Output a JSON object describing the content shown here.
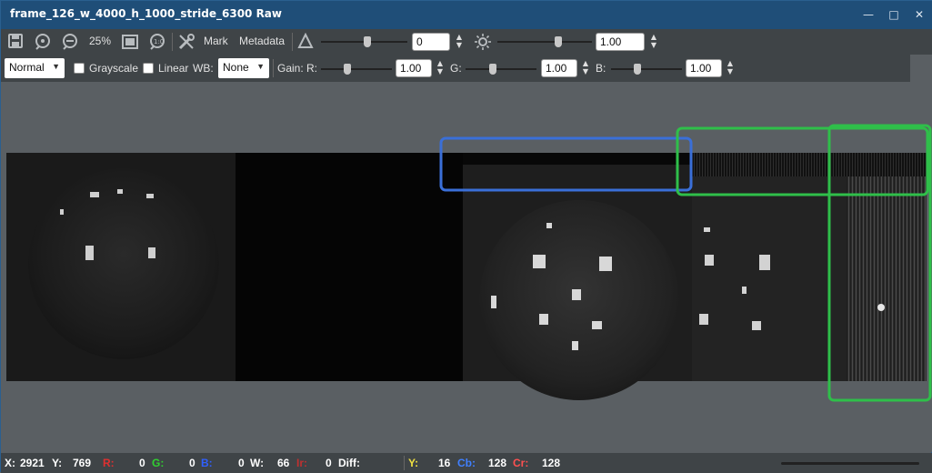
{
  "window": {
    "title": "frame_126_w_4000_h_1000_stride_6300 Raw",
    "minimize": "—",
    "maximize": "□",
    "close": "✕"
  },
  "toolbar1": {
    "zoom_label": "25%",
    "mark_label": "Mark",
    "metadata_label": "Metadata",
    "contrast_value": "0",
    "brightness_value": "1.00"
  },
  "toolbar2": {
    "blend_mode": "Normal",
    "grayscale_label": "Grayscale",
    "linear_label": "Linear",
    "wb_label": "WB:",
    "wb_value": "None",
    "gain_label": "Gain:",
    "r_label": "R:",
    "r_value": "1.00",
    "g_label": "G:",
    "g_value": "1.00",
    "b_label": "B:",
    "b_value": "1.00"
  },
  "status": {
    "x_label": "X:",
    "x_value": "2921",
    "y_label": "Y:",
    "y_value": "769",
    "r_label": "R:",
    "r_value": "0",
    "g_label": "G:",
    "g_value": "0",
    "b_label": "B:",
    "b_value": "0",
    "w_label": "W:",
    "w_value": "66",
    "ir_label": "Ir:",
    "ir_value": "0",
    "diff_label": "Diff:",
    "yy_label": "Y:",
    "yy_value": "16",
    "cb_label": "Cb:",
    "cb_value": "128",
    "cr_label": "Cr:",
    "cr_value": "128"
  },
  "colors": {
    "title_bg": "#1f4e78",
    "toolbar_bg": "#3f4447",
    "canvas_bg": "#5a5f63",
    "annotation_blue": "#3a6fd8",
    "annotation_green": "#2fbf4a",
    "status_r": "#e03030",
    "status_g": "#30d030",
    "status_b": "#3060ff",
    "status_ir": "#c03030",
    "status_y": "#f0e040",
    "status_cb": "#4080ff",
    "status_cr": "#ff5050"
  },
  "icons": [
    "save-icon",
    "zoom-in-icon",
    "zoom-out-icon",
    "fit-icon",
    "actual-size-icon",
    "tools-icon",
    "contrast-icon",
    "brightness-icon"
  ]
}
